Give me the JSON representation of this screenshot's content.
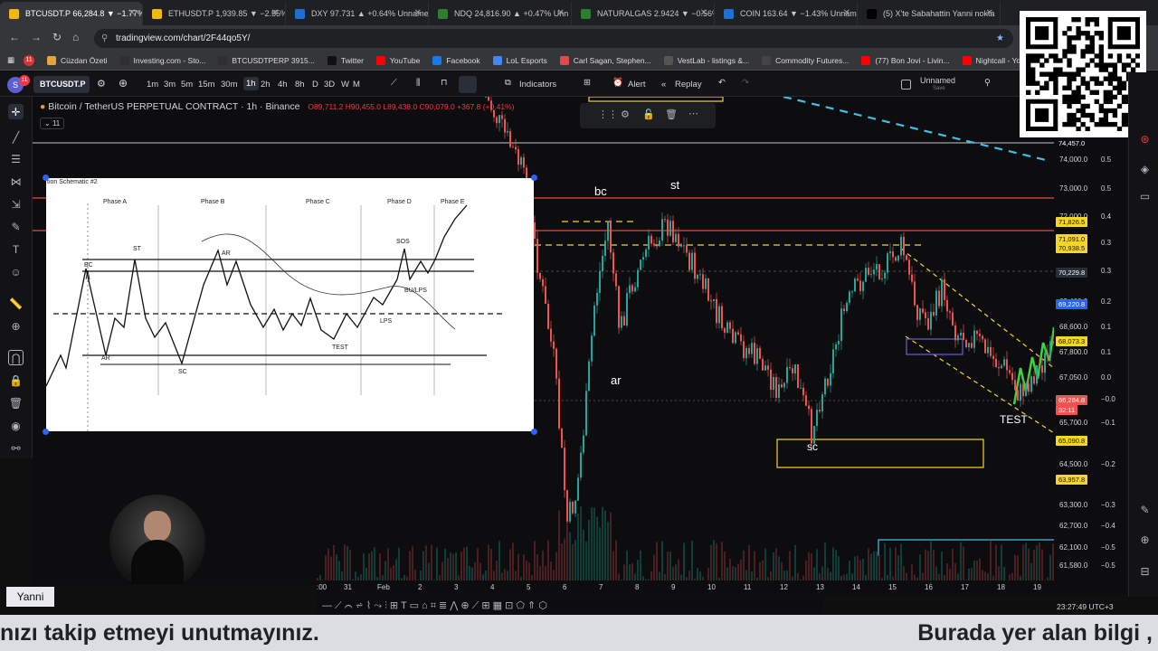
{
  "tabs": [
    {
      "label": "BTCUSDT.P 66,284.8 ▼ −1.77%",
      "active": true
    },
    {
      "label": "ETHUSDT.P 1,939.85 ▼ −2.55%"
    },
    {
      "label": "DXY 97.731 ▲ +0.64% Unname"
    },
    {
      "label": "NDQ 24,816.90 ▲ +0.47% Unn"
    },
    {
      "label": "NATURALGAS 2.9424 ▼ −0.56%"
    },
    {
      "label": "COIN 163.64 ▼ −1.43% Unnam"
    },
    {
      "label": "(5) X'te Sabahattin Yanni nokta"
    }
  ],
  "address": "tradingview.com/chart/2F44qo5Y/",
  "bookmarks": [
    {
      "label": "Cüzdan Özeti",
      "color": "#e8a23a"
    },
    {
      "label": "Investing.com - Sto...",
      "color": "#2f2f2f"
    },
    {
      "label": "BTCUSDTPERP 3915...",
      "color": "#2f2f2f"
    },
    {
      "label": "Twitter",
      "color": "#111111"
    },
    {
      "label": "YouTube",
      "color": "#ff0000"
    },
    {
      "label": "Facebook",
      "color": "#1877f2"
    },
    {
      "label": "LoL Esports",
      "color": "#3d8af7"
    },
    {
      "label": "Carl Sagan, Stephen...",
      "color": "#e04a4a"
    },
    {
      "label": "VestLab - listings &...",
      "color": "#555"
    },
    {
      "label": "Commodity Futures...",
      "color": "#444"
    },
    {
      "label": "(77) Bon Jovi - Livin...",
      "color": "#ff0000"
    },
    {
      "label": "Nightcall - YouTube",
      "color": "#ff0000"
    }
  ],
  "toolbar": {
    "symbol": "BTCUSDT.P",
    "timeframes": [
      "1m",
      "3m",
      "5m",
      "15m",
      "30m",
      "1h",
      "2h",
      "4h",
      "8h",
      "D",
      "3D",
      "W",
      "M"
    ],
    "active_tf": "1h",
    "indicators": "Indicators",
    "alert": "Alert",
    "replay": "Replay",
    "layout_name": "Unnamed",
    "layout_sub": "Save",
    "notif_badge": "11"
  },
  "legend": {
    "title": "Bitcoin / TetherUS PERPETUAL CONTRACT · 1h · Binance",
    "ohlc": "O89,711.2 H90,455.0 L89,438.0 C90,079.0 +367.8 (+0.41%)",
    "indicators_count": "11"
  },
  "schematic": {
    "title": "tion Schematic #2",
    "phases": [
      "Phase A",
      "Phase B",
      "Phase C",
      "Phase D",
      "Phase E"
    ],
    "labels": {
      "bc": "BC",
      "st": "ST",
      "ar_top": "AR",
      "ar": "AR",
      "sc": "SC",
      "sos": "SOS",
      "bu": "BU/LPS",
      "lps": "LPS",
      "test": "TEST"
    }
  },
  "annotations": {
    "bc": "bc",
    "st": "st",
    "ar": "ar",
    "sc": "sc",
    "test": "TEST"
  },
  "price_axis": [
    "74,000.0",
    "73,000.0",
    "72,000.0",
    "71,000.0",
    "70,200.0",
    "69,400.0",
    "68,600.0",
    "67,800.0",
    "67,050.0",
    "66,200.0",
    "65,700.0",
    "64,500.0",
    "63,300.0",
    "62,700.0",
    "62,100.0",
    "61,580.0"
  ],
  "price_axis_pct": [
    "0.5",
    "0.5",
    "0.4",
    "0.3",
    "0.3",
    "0.2",
    "0.1",
    "0.1",
    "0.0",
    "−0.0",
    "−0.1",
    "−0.2",
    "−0.3",
    "−0.4",
    "−0.5",
    "−0.5"
  ],
  "price_labels": [
    {
      "text": "74,457.0",
      "bg": "#0d0d10",
      "fg": "#ffffff"
    },
    {
      "text": "71,826.5",
      "bg": "#f5d623",
      "fg": "#111"
    },
    {
      "text": "71,091.0",
      "bg": "#f5d623",
      "fg": "#111"
    },
    {
      "text": "70,938.5",
      "bg": "#f5d623",
      "fg": "#111"
    },
    {
      "text": "70,229.8",
      "bg": "#2a2e39",
      "fg": "#ffffff"
    },
    {
      "text": "69,220.8",
      "bg": "#2962ff",
      "fg": "#ffffff"
    },
    {
      "text": "68,073.3",
      "bg": "#f5d623",
      "fg": "#111"
    },
    {
      "text": "66,284.8",
      "bg": "#ef5350",
      "fg": "#ffffff"
    },
    {
      "text": "32:11",
      "bg": "#ef5350",
      "fg": "#ffffff"
    },
    {
      "text": "65,090.8",
      "bg": "#f5d623",
      "fg": "#111"
    },
    {
      "text": "63,957.8",
      "bg": "#f5d623",
      "fg": "#111"
    }
  ],
  "time_axis": [
    ":00",
    "31",
    "Feb",
    "2",
    "3",
    "4",
    "5",
    "6",
    "7",
    "8",
    "9",
    "10",
    "11",
    "12",
    "13",
    "14",
    "15",
    "16",
    "17",
    "18",
    "19"
  ],
  "clock": "23:27:49 UTC+3",
  "webcam_name": "Yanni",
  "footer": {
    "left": "nızı takip etmeyi unutmayınız.",
    "right": "Burada yer alan bilgi ,"
  }
}
